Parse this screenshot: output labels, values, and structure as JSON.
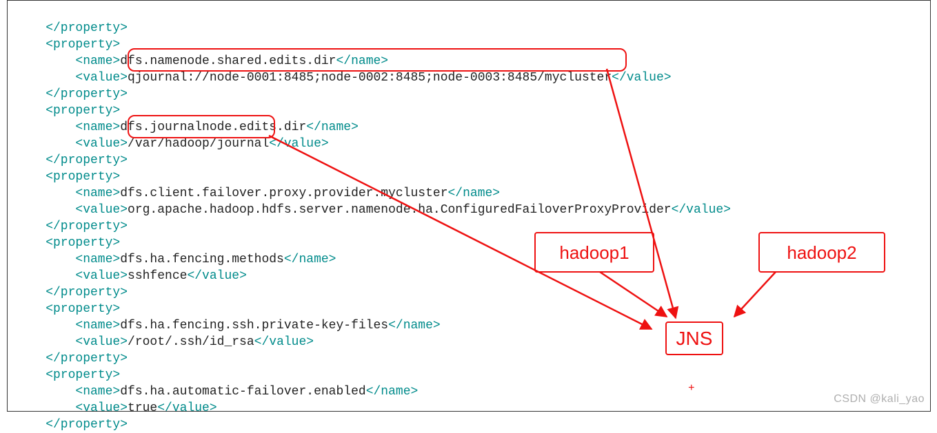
{
  "code": {
    "tags": {
      "propOpen": "<property>",
      "propClose": "</property>",
      "nameOpen": "<name>",
      "nameClose": "</name>",
      "valueOpen": "<value>",
      "valueClose": "</value>"
    },
    "props": [
      {
        "name": "dfs.namenode.shared.edits.dir",
        "value": "qjournal://node-0001:8485;node-0002:8485;node-0003:8485/mycluster"
      },
      {
        "name": "dfs.journalnode.edits.dir",
        "value": "/var/hadoop/journal"
      },
      {
        "name": "dfs.client.failover.proxy.provider.mycluster",
        "value": "org.apache.hadoop.hdfs.server.namenode.ha.ConfiguredFailoverProxyProvider"
      },
      {
        "name": "dfs.ha.fencing.methods",
        "value": "sshfence"
      },
      {
        "name": "dfs.ha.fencing.ssh.private-key-files",
        "value": "/root/.ssh/id_rsa"
      },
      {
        "name": "dfs.ha.automatic-failover.enabled",
        "value": "true"
      }
    ]
  },
  "annotations": {
    "box1": "hadoop1",
    "box2": "hadoop2",
    "box3": "JNS"
  },
  "watermark": "CSDN @kali_yao"
}
